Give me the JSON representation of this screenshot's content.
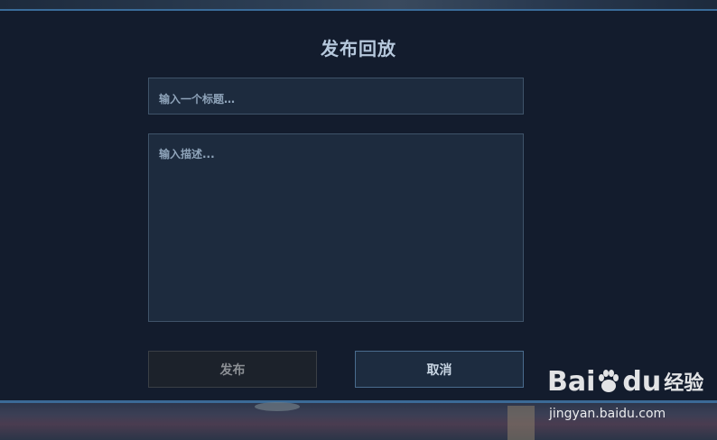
{
  "dialog": {
    "title": "发布回放",
    "title_input": {
      "placeholder": "输入一个标题…"
    },
    "description_input": {
      "placeholder": "输入描述..."
    },
    "publish_label": "发布",
    "cancel_label": "取消"
  },
  "watermark": {
    "logo_text_1": "Bai",
    "logo_text_2": "du",
    "logo_text_3": "经验",
    "url": "jingyan.baidu.com"
  },
  "colors": {
    "background": "#131c2d",
    "field_bg": "#1d2b3e",
    "field_border": "#3f5369",
    "accent_line": "#3a6c9a"
  }
}
